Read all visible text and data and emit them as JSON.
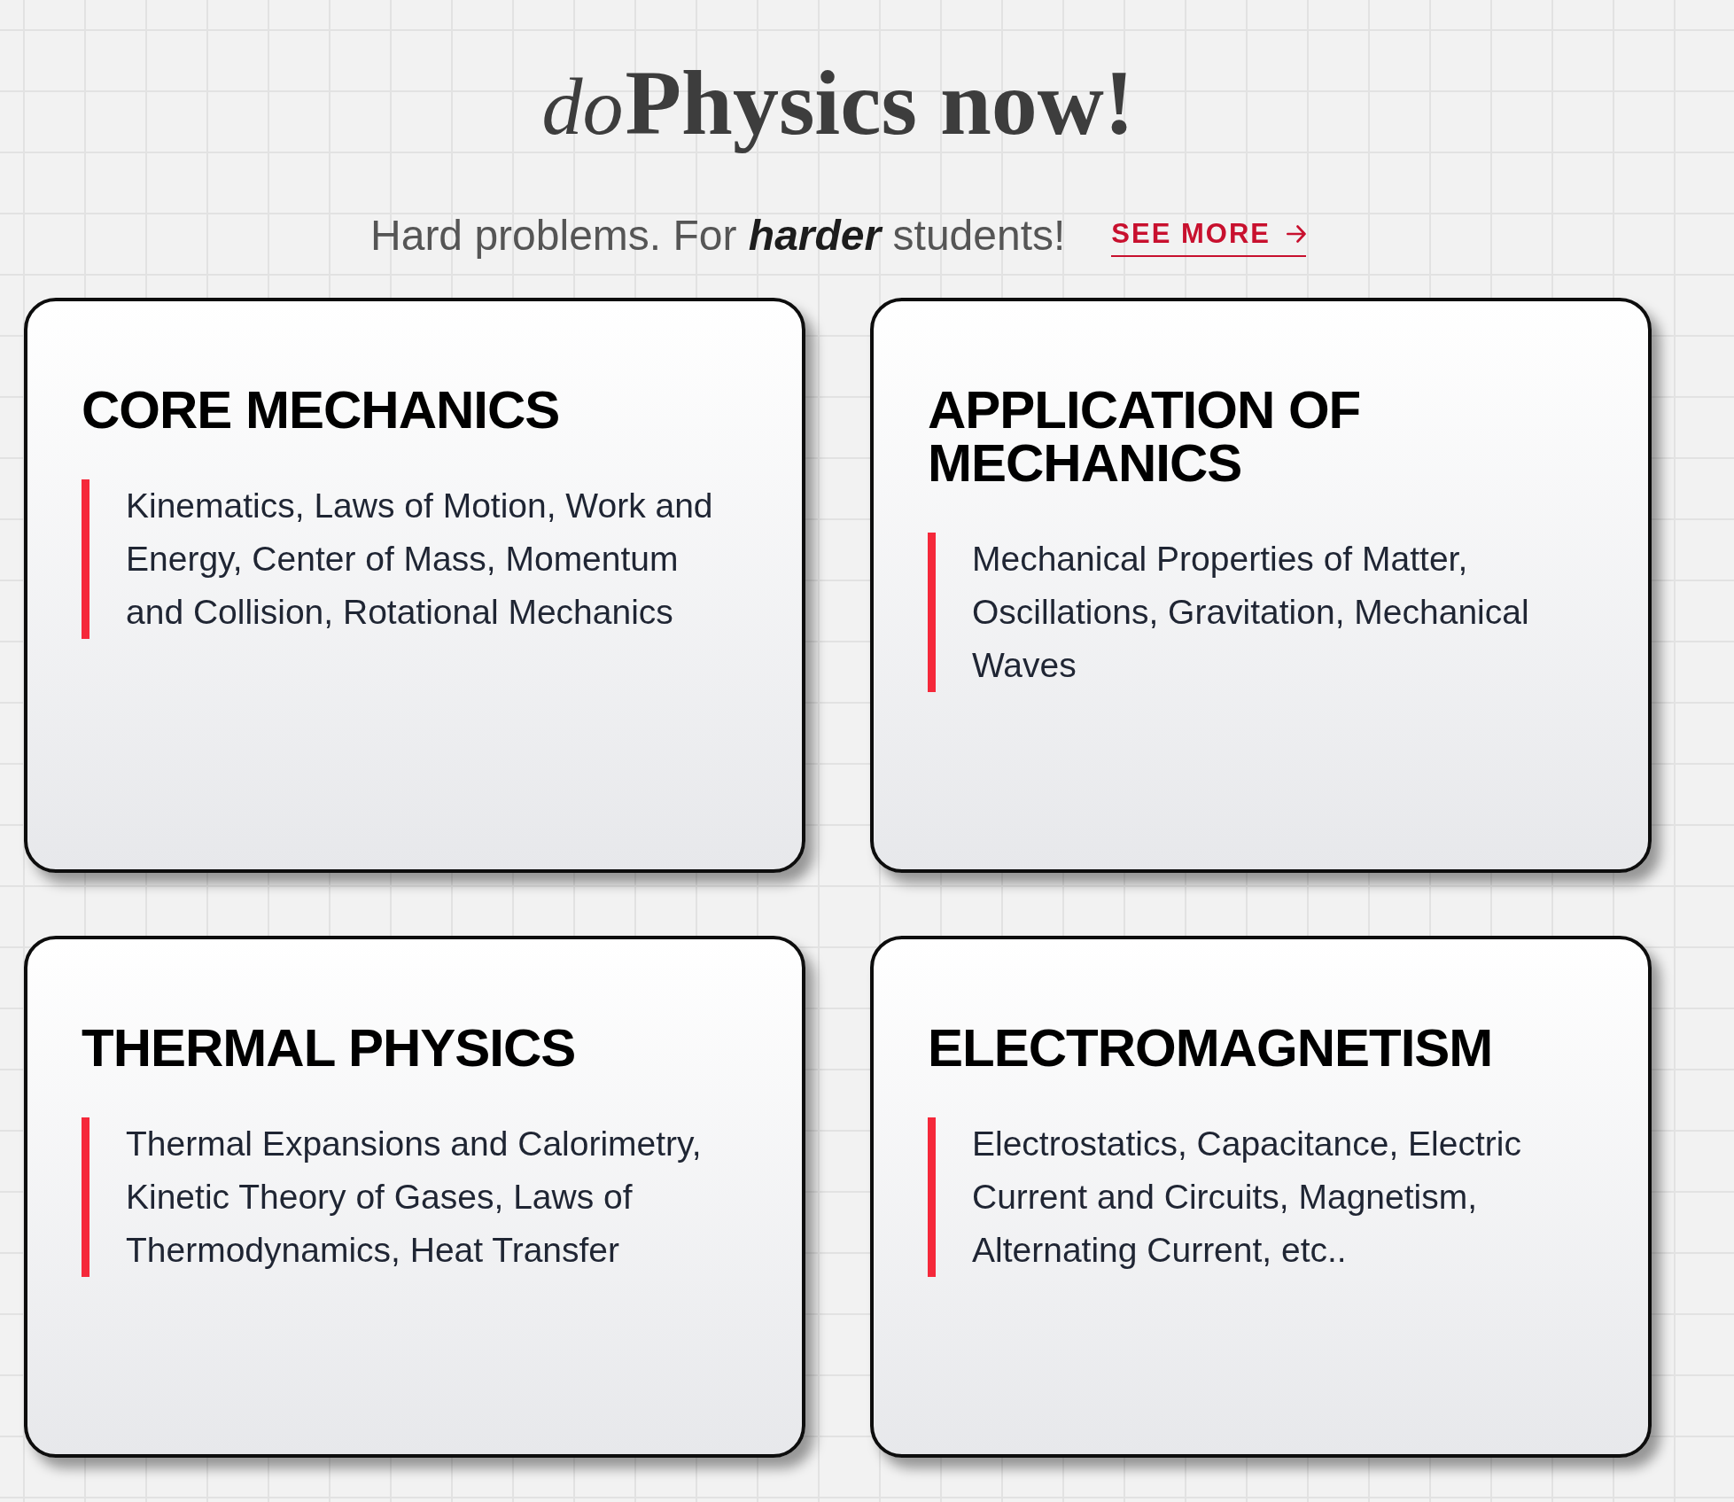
{
  "header": {
    "title": {
      "prefix": "do",
      "main": "Physics now!"
    },
    "tagline": "Hard problems. For **harder** students!",
    "link": {
      "label": "SEE MORE"
    }
  },
  "cards": [
    {
      "title": "CORE MECHANICS",
      "topics": "Kinematics, Laws of Motion, Work and Energy, Center of Mass, Momentum and Collision, Rotational Mechanics"
    },
    {
      "title": "APPLICATION OF MECHANICS",
      "topics": "Mechanical Properties of Matter, Oscillations, Gravitation, Mechanical Waves"
    },
    {
      "title": "THERMAL PHYSICS",
      "topics": "Thermal Expansions and Calorimetry, Kinetic Theory of Gases, Laws of Thermodynamics, Heat Transfer"
    },
    {
      "title": "ELECTROMAGNETISM",
      "topics": "Electrostatics, Capacitance, Electric Current and Circuits, Magnetism, Alternating Current, etc.."
    }
  ]
}
